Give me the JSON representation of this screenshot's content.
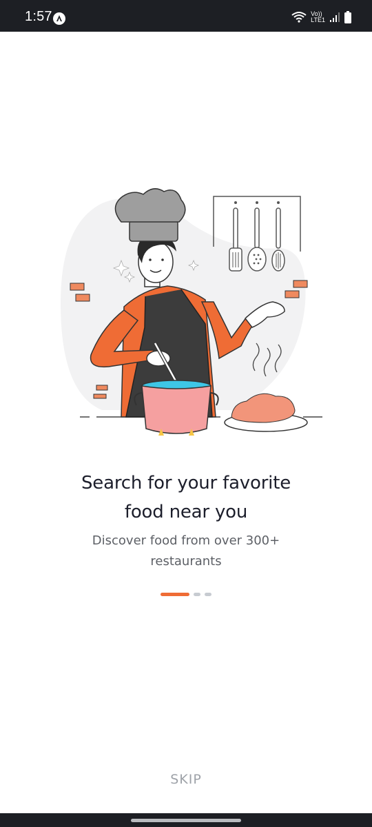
{
  "status_bar": {
    "time": "1:57",
    "app_icon": "app-notification-icon",
    "wifi_icon": "wifi-icon",
    "volte_top": "Vo))",
    "volte_bottom": "LTE1",
    "signal_icon": "signal-icon",
    "battery_icon": "battery-icon"
  },
  "onboarding": {
    "illustration": "chef-cooking-illustration",
    "title_line1": "Search for your favorite",
    "title_line2": "food near you",
    "subtitle_line1": "Discover food from over 300+",
    "subtitle_line2": "restaurants",
    "current_page": 1,
    "total_pages": 3
  },
  "actions": {
    "skip_label": "SKIP"
  },
  "colors": {
    "accent": "#ef6c35",
    "title": "#1c1e2b",
    "subtitle": "#5d6066",
    "inactive_dot": "#c7cbd1",
    "skip": "#9ea2a8"
  }
}
